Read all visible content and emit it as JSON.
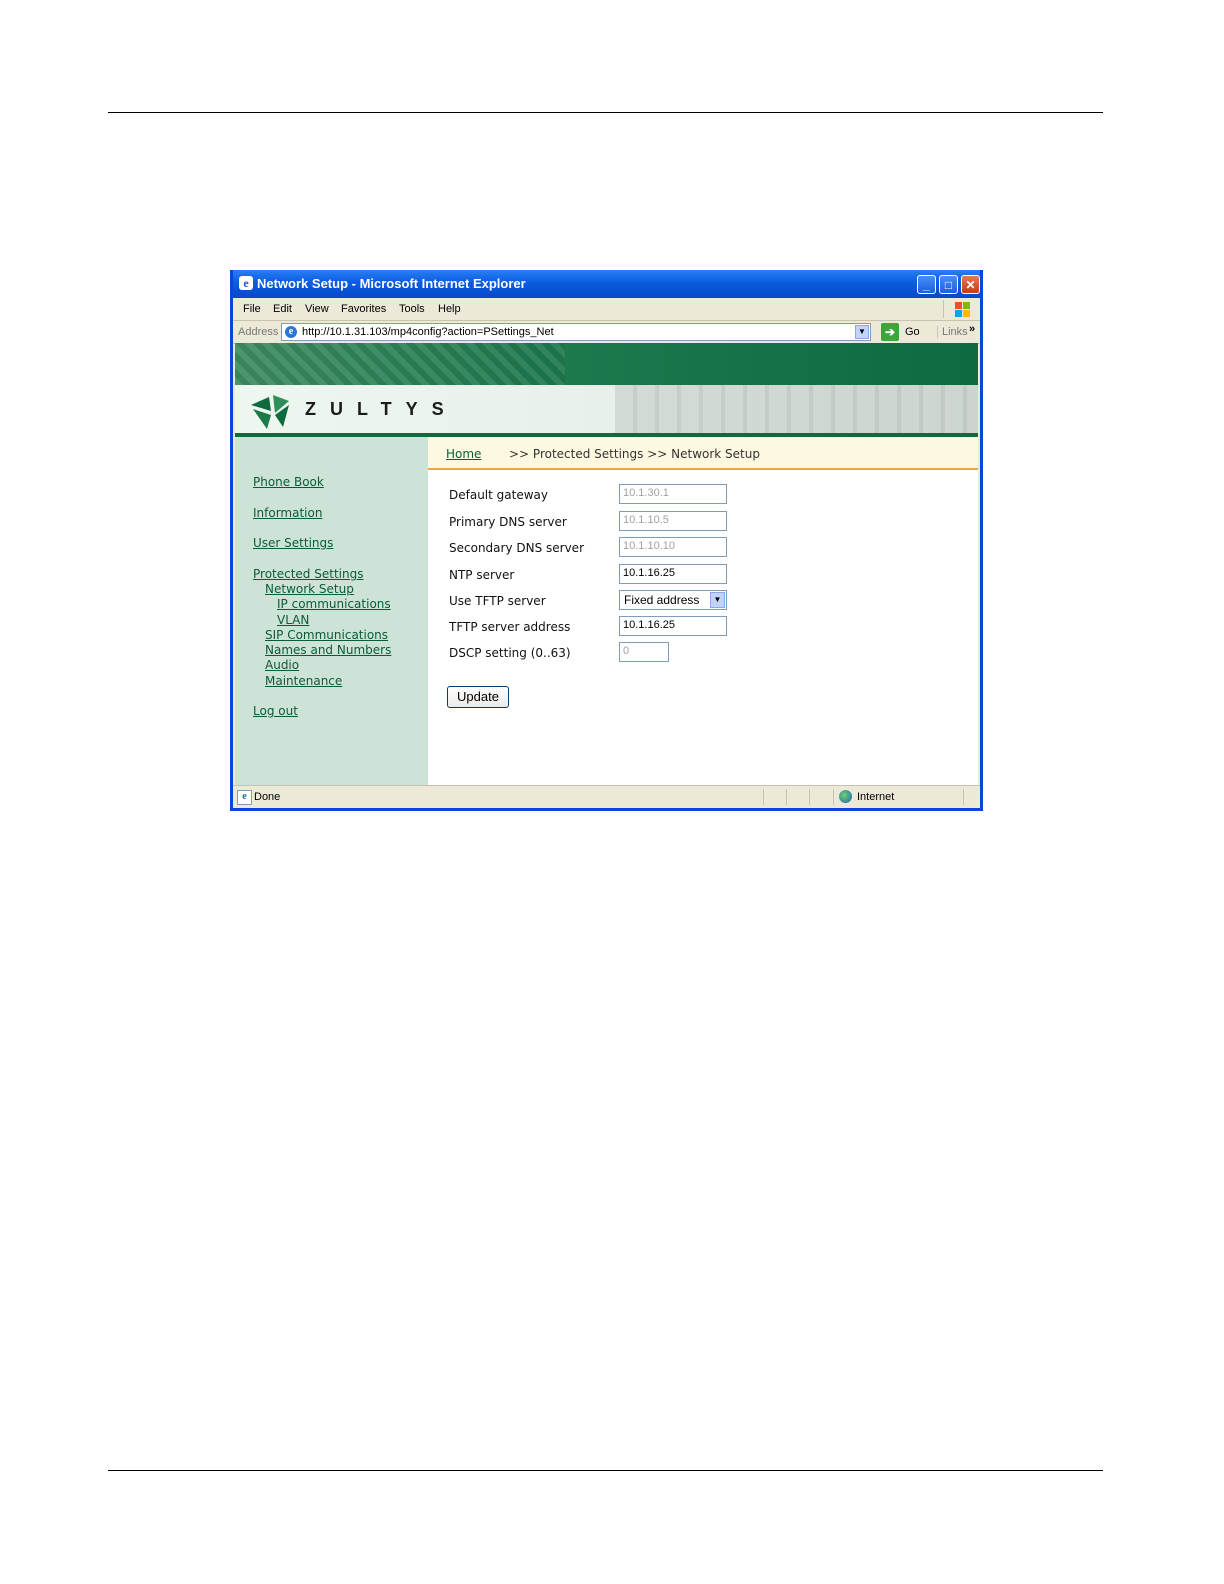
{
  "window": {
    "title": "Network Setup - Microsoft Internet Explorer",
    "menu": [
      "File",
      "Edit",
      "View",
      "Favorites",
      "Tools",
      "Help"
    ],
    "address_label": "Address",
    "url": "http://10.1.31.103/mp4config?action=PSettings_Net",
    "go_label": "Go",
    "links_label": "Links"
  },
  "brand": {
    "name": "ZULTYS"
  },
  "sidebar": {
    "items": [
      {
        "label": "Phone Book"
      },
      {
        "label": "Information"
      },
      {
        "label": "User Settings"
      },
      {
        "label": "Protected Settings"
      },
      {
        "label": "Network Setup"
      },
      {
        "label": "IP communications"
      },
      {
        "label": "VLAN"
      },
      {
        "label": "SIP Communications"
      },
      {
        "label": "Names and Numbers"
      },
      {
        "label": "Audio"
      },
      {
        "label": "Maintenance"
      },
      {
        "label": "Log out"
      }
    ]
  },
  "breadcrumb": {
    "home": "Home",
    "rest": ">> Protected Settings >> Network Setup"
  },
  "form": {
    "fields": [
      {
        "label": "Default gateway",
        "value": "10.1.30.1"
      },
      {
        "label": "Primary DNS server",
        "value": "10.1.10.5"
      },
      {
        "label": "Secondary DNS server",
        "value": "10.1.10.10"
      },
      {
        "label": "NTP server",
        "value": "10.1.16.25"
      },
      {
        "label": "Use TFTP server",
        "value": "Fixed address"
      },
      {
        "label": "TFTP server address",
        "value": "10.1.16.25"
      },
      {
        "label": "DSCP setting (0..63)",
        "value": "0"
      }
    ],
    "update_label": "Update"
  },
  "status": {
    "text": "Done",
    "zone": "Internet"
  },
  "colors": {
    "accent": "#0e6b3e",
    "link": "#0a5c36",
    "sidebar": "#cde3d7",
    "titlebar": "#0a5ce0"
  }
}
